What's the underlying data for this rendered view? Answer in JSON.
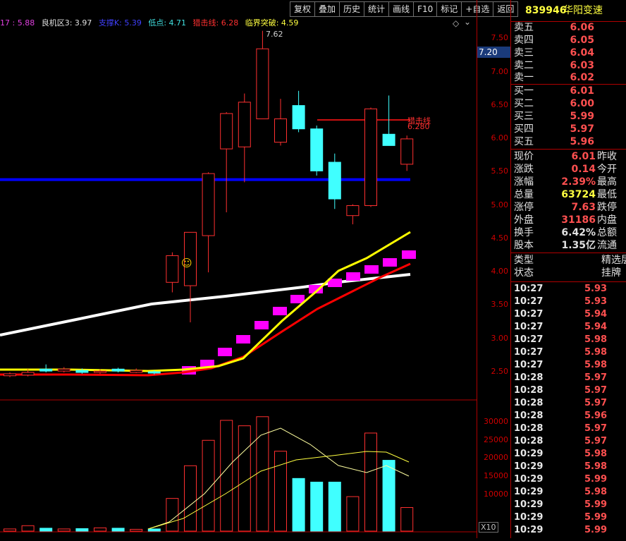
{
  "toolbar": {
    "buttons": [
      "复权",
      "叠加",
      "历史",
      "统计",
      "画线",
      "F10",
      "标记",
      "+自选",
      "返回"
    ]
  },
  "indicator_bar": [
    {
      "text": "17 : 5.88",
      "color": "#e040e0"
    },
    {
      "text": "良机区3: 3.97",
      "color": "#e0e0e0"
    },
    {
      "text": "支撑K: 5.39",
      "color": "#4040ff"
    },
    {
      "text": "低点: 4.71",
      "color": "#40e0e0"
    },
    {
      "text": "猎击线: 6.28",
      "color": "#ff3030"
    },
    {
      "text": "临界突破: 4.59",
      "color": "#ffff40"
    }
  ],
  "chart_labels": {
    "high_label": "7.62",
    "hunt_line_label": "猎击线",
    "hunt_line_value": "6.280",
    "smile": "☺",
    "vol_unit": "X10",
    "diamond": "◇",
    "chevron": "⌄"
  },
  "price_axis": {
    "ticks": [
      "7.50",
      "7.00",
      "6.50",
      "6.00",
      "5.50",
      "5.00",
      "4.50",
      "4.00",
      "3.50",
      "3.00",
      "2.50"
    ],
    "current": "7.20"
  },
  "volume_axis": {
    "ticks": [
      "30000",
      "25000",
      "20000",
      "15000",
      "10000"
    ]
  },
  "stock": {
    "code": "839946",
    "name": "华阳变速"
  },
  "order_book": {
    "sell": [
      {
        "label": "卖五",
        "price": "6.06"
      },
      {
        "label": "卖四",
        "price": "6.05"
      },
      {
        "label": "卖三",
        "price": "6.04"
      },
      {
        "label": "卖二",
        "price": "6.03"
      },
      {
        "label": "卖一",
        "price": "6.02"
      }
    ],
    "buy": [
      {
        "label": "买一",
        "price": "6.01"
      },
      {
        "label": "买二",
        "price": "6.00"
      },
      {
        "label": "买三",
        "price": "5.99"
      },
      {
        "label": "买四",
        "price": "5.97"
      },
      {
        "label": "买五",
        "price": "5.96"
      }
    ]
  },
  "stats": [
    {
      "label": "现价",
      "value": "6.01",
      "color": "#ff5050",
      "label2": "昨收"
    },
    {
      "label": "涨跌",
      "value": "0.14",
      "color": "#ff5050",
      "label2": "今开"
    },
    {
      "label": "涨幅",
      "value": "2.39%",
      "color": "#ff5050",
      "label2": "最高"
    },
    {
      "label": "总量",
      "value": "63724",
      "color": "#ffff40",
      "label2": "最低"
    },
    {
      "label": "涨停",
      "value": "7.63",
      "color": "#ff5050",
      "label2": "跌停"
    },
    {
      "label": "外盘",
      "value": "31186",
      "color": "#ff5050",
      "label2": "内盘"
    },
    {
      "label": "换手",
      "value": "6.42%",
      "color": "#e0e0e0",
      "label2": "总额"
    },
    {
      "label": "股本",
      "value": "1.35亿",
      "color": "#e0e0e0",
      "label2": "流通"
    }
  ],
  "info": [
    {
      "label": "类型",
      "value": "精选层"
    },
    {
      "label": "状态",
      "value": "挂牌"
    }
  ],
  "ticks": [
    {
      "time": "10:27",
      "price": "5.93"
    },
    {
      "time": "10:27",
      "price": "5.93"
    },
    {
      "time": "10:27",
      "price": "5.94"
    },
    {
      "time": "10:27",
      "price": "5.94"
    },
    {
      "time": "10:27",
      "price": "5.98"
    },
    {
      "time": "10:27",
      "price": "5.98"
    },
    {
      "time": "10:27",
      "price": "5.98"
    },
    {
      "time": "10:28",
      "price": "5.97"
    },
    {
      "time": "10:28",
      "price": "5.97"
    },
    {
      "time": "10:28",
      "price": "5.97"
    },
    {
      "time": "10:28",
      "price": "5.96"
    },
    {
      "time": "10:28",
      "price": "5.97"
    },
    {
      "time": "10:28",
      "price": "5.97"
    },
    {
      "time": "10:29",
      "price": "5.98"
    },
    {
      "time": "10:29",
      "price": "5.98"
    },
    {
      "time": "10:29",
      "price": "5.99"
    },
    {
      "time": "10:29",
      "price": "5.98"
    },
    {
      "time": "10:29",
      "price": "5.99"
    },
    {
      "time": "10:29",
      "price": "5.99"
    },
    {
      "time": "10:29",
      "price": "5.99"
    }
  ],
  "colors": {
    "up": "#ff3030",
    "down": "#40ffff",
    "support_line": "#0000ff",
    "ma_white": "#ffffff",
    "ma_yellow": "#ffff00",
    "ma_red": "#ff0000",
    "magenta": "#ff00ff"
  },
  "chart_data": {
    "type": "candlestick",
    "price_ylim": [
      2.2,
      7.8
    ],
    "candles": [
      {
        "o": 2.45,
        "c": 2.48,
        "h": 2.5,
        "l": 2.43
      },
      {
        "o": 2.46,
        "c": 2.5,
        "h": 2.55,
        "l": 2.44
      },
      {
        "o": 2.55,
        "c": 2.52,
        "h": 2.62,
        "l": 2.5
      },
      {
        "o": 2.52,
        "c": 2.55,
        "h": 2.58,
        "l": 2.5
      },
      {
        "o": 2.53,
        "c": 2.5,
        "h": 2.56,
        "l": 2.48
      },
      {
        "o": 2.5,
        "c": 2.52,
        "h": 2.55,
        "l": 2.48
      },
      {
        "o": 2.55,
        "c": 2.52,
        "h": 2.57,
        "l": 2.5
      },
      {
        "o": 2.5,
        "c": 2.53,
        "h": 2.56,
        "l": 2.49
      },
      {
        "o": 2.51,
        "c": 2.49,
        "h": 2.53,
        "l": 2.47
      },
      {
        "o": 3.85,
        "c": 4.25,
        "h": 4.3,
        "l": 3.7
      },
      {
        "o": 3.8,
        "c": 4.6,
        "h": 3.6,
        "l": 3.25
      },
      {
        "o": 4.55,
        "c": 5.48,
        "h": 5.5,
        "l": 4.0
      },
      {
        "o": 5.85,
        "c": 6.38,
        "h": 6.4,
        "l": 4.9
      },
      {
        "o": 5.88,
        "c": 6.55,
        "h": 6.68,
        "l": 5.35
      },
      {
        "o": 6.3,
        "c": 7.35,
        "h": 7.62,
        "l": 6.3
      },
      {
        "o": 5.95,
        "c": 6.3,
        "h": 6.6,
        "l": 5.9
      },
      {
        "o": 6.5,
        "c": 6.15,
        "h": 6.72,
        "l": 6.1
      },
      {
        "o": 6.15,
        "c": 5.52,
        "h": 6.2,
        "l": 5.45
      },
      {
        "o": 5.65,
        "c": 5.1,
        "h": 5.78,
        "l": 4.95
      },
      {
        "o": 4.85,
        "c": 5.0,
        "h": 5.02,
        "l": 4.72
      },
      {
        "o": 5.0,
        "c": 6.45,
        "h": 6.47,
        "l": 4.98
      },
      {
        "o": 6.07,
        "c": 5.9,
        "h": 6.65,
        "l": 5.9
      },
      {
        "o": 5.62,
        "c": 6.0,
        "h": 6.05,
        "l": 5.52
      }
    ],
    "support_line": 5.39,
    "hunt_line": 6.28,
    "volume_ylim": [
      0,
      33000
    ],
    "volume": [
      600,
      1500,
      800,
      600,
      700,
      900,
      800,
      500,
      600,
      9000,
      18000,
      25000,
      30500,
      29000,
      31500,
      22000,
      14500,
      13500,
      13500,
      9500,
      27000,
      19500,
      6500
    ]
  }
}
